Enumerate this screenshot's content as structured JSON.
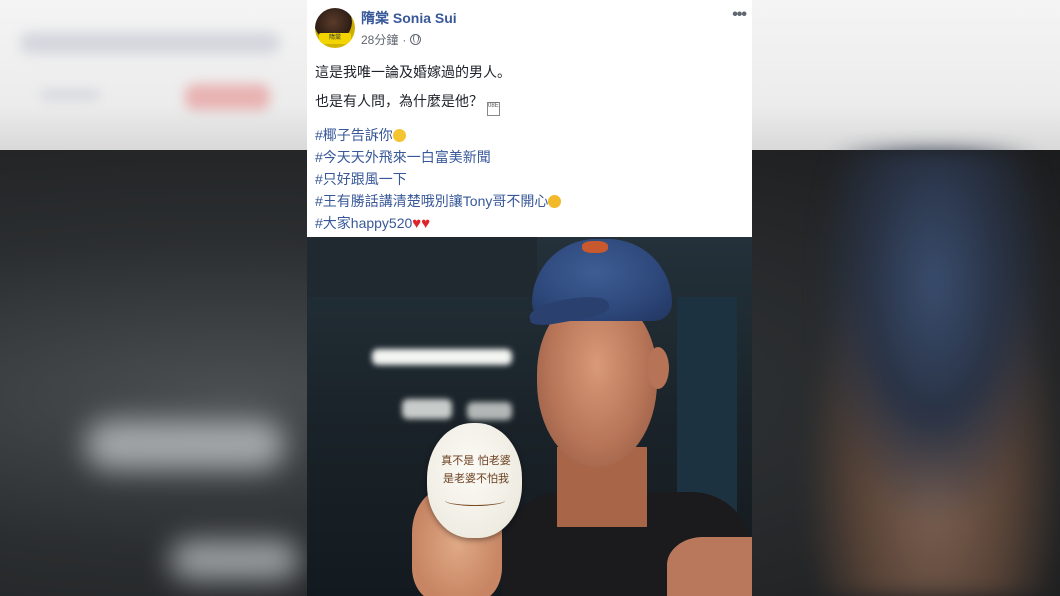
{
  "post": {
    "author": "隋棠 Sonia Sui",
    "timestamp": "28分鐘",
    "separator": "·",
    "more_label": "•••",
    "avatar_badge": "隋棠",
    "lines": [
      "這是我唯一論及婚嫁過的男人。",
      "也是有人問，為什麼是他？"
    ],
    "hashtags": [
      {
        "text": "#椰子告訴你",
        "emoji": "grin"
      },
      {
        "text": "#今天天外飛來一白富美新聞",
        "emoji": ""
      },
      {
        "text": "#只好跟風一下",
        "emoji": ""
      },
      {
        "text": "#王有勝話講清楚哦別讓Tony哥不開心",
        "emoji": "crazy"
      },
      {
        "text": "#大家happy520",
        "emoji": "hearts"
      }
    ],
    "photo": {
      "coconut_lines": [
        "真不是 怕老婆",
        "是老婆不怕我"
      ]
    }
  },
  "colors": {
    "link": "#385898",
    "text": "#1d2129",
    "meta": "#616770",
    "heart": "#e0242a"
  }
}
